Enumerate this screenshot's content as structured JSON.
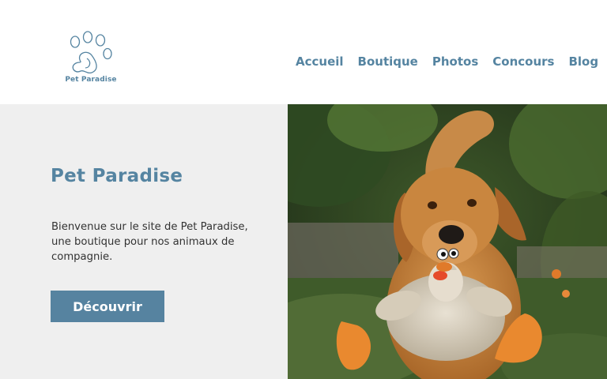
{
  "brand": {
    "name": "Pet Paradise",
    "logo_icon": "paw-icon"
  },
  "nav": {
    "items": [
      {
        "label": "Accueil"
      },
      {
        "label": "Boutique"
      },
      {
        "label": "Photos"
      },
      {
        "label": "Concours"
      },
      {
        "label": "Blog"
      }
    ]
  },
  "hero": {
    "title": "Pet Paradise",
    "description": "Bienvenue sur le site de Pet Paradise, une boutique pour nos animaux de compagnie.",
    "cta_label": "Découvrir",
    "image_alt": "Golden retriever tenant un jouet en peluche"
  },
  "colors": {
    "accent": "#5584a1",
    "button": "#5683a0",
    "hero_bg": "#efefef"
  }
}
